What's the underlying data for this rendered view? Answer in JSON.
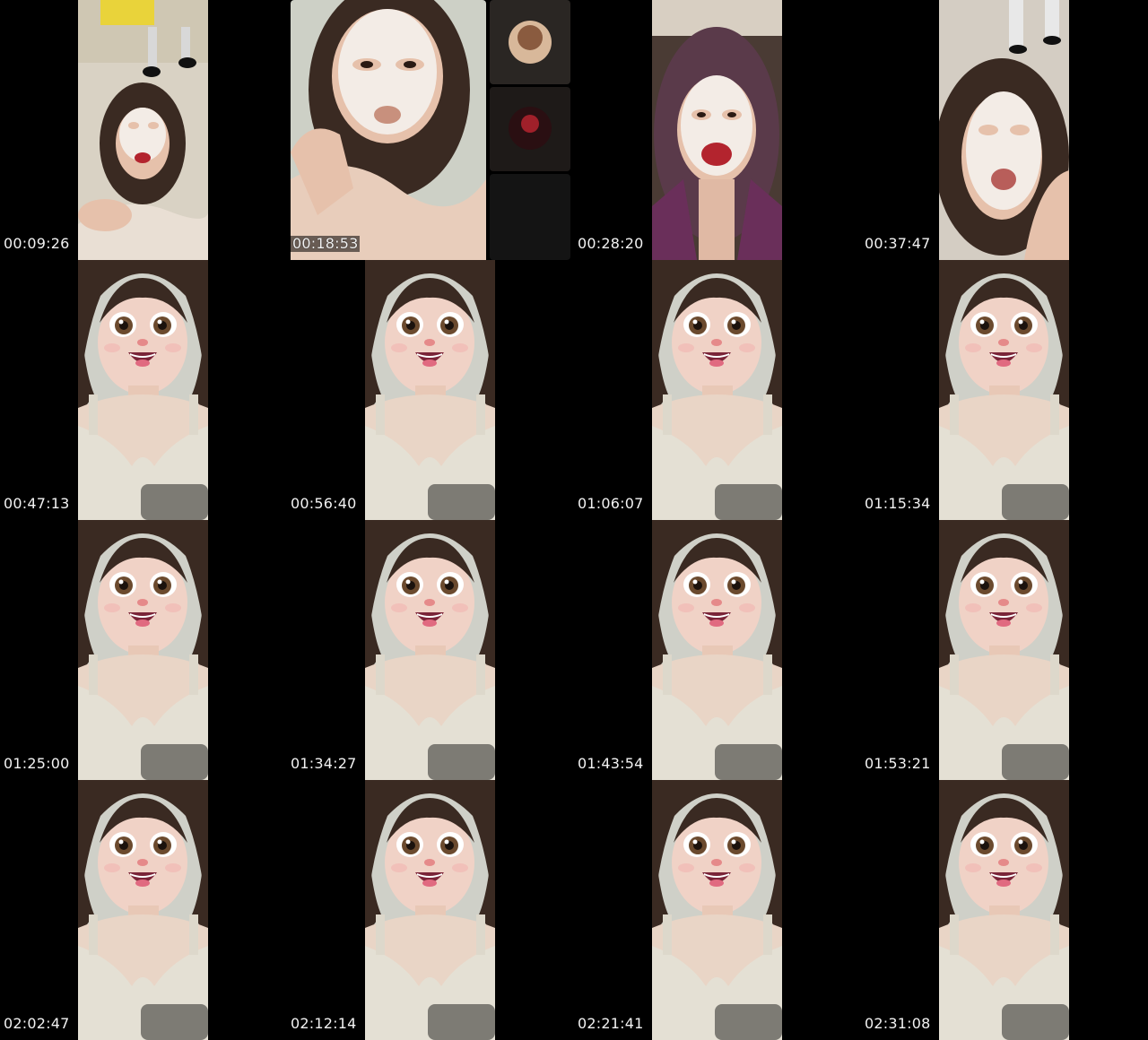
{
  "thumbnails": [
    {
      "time": "00:09:26",
      "scene": "masked-face-bed"
    },
    {
      "time": "00:18:53",
      "scene": "masked-face-videocall"
    },
    {
      "time": "00:28:20",
      "scene": "masked-face-red-lips"
    },
    {
      "time": "00:37:47",
      "scene": "masked-face-tongue"
    },
    {
      "time": "00:47:13",
      "scene": "cartoon-filter"
    },
    {
      "time": "00:56:40",
      "scene": "cartoon-filter"
    },
    {
      "time": "01:06:07",
      "scene": "cartoon-filter"
    },
    {
      "time": "01:15:34",
      "scene": "cartoon-filter"
    },
    {
      "time": "01:25:00",
      "scene": "cartoon-filter"
    },
    {
      "time": "01:34:27",
      "scene": "cartoon-filter"
    },
    {
      "time": "01:43:54",
      "scene": "cartoon-filter"
    },
    {
      "time": "01:53:21",
      "scene": "cartoon-filter"
    },
    {
      "time": "02:02:47",
      "scene": "cartoon-filter"
    },
    {
      "time": "02:12:14",
      "scene": "cartoon-filter"
    },
    {
      "time": "02:21:41",
      "scene": "cartoon-filter"
    },
    {
      "time": "02:31:08",
      "scene": "cartoon-filter"
    }
  ],
  "colors": {
    "background": "#000000",
    "timestamp_text": "#f2f2f2",
    "skin": "#e8c3b0",
    "mask": "#f3ece6",
    "hair": "#3a2a22",
    "lips": "#b3242e",
    "top": "#e6e2d8"
  }
}
